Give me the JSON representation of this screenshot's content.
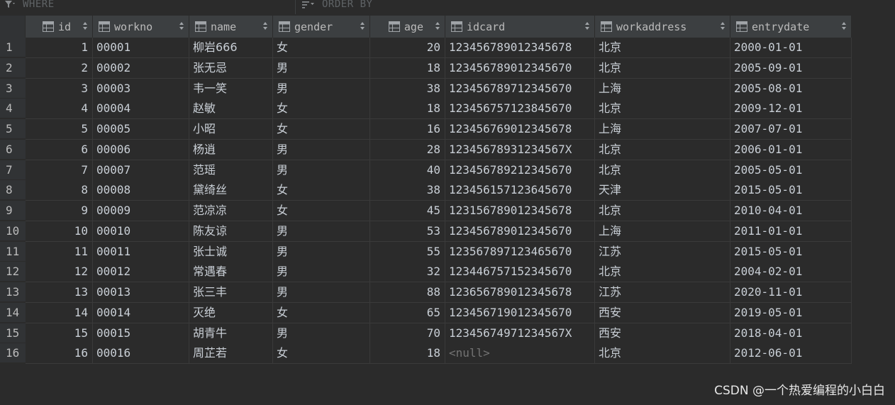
{
  "filter": {
    "where_label": "WHERE",
    "order_by_label": "ORDER BY"
  },
  "columns": [
    {
      "key": "id",
      "label": "id",
      "align": "right"
    },
    {
      "key": "workno",
      "label": "workno",
      "align": "left"
    },
    {
      "key": "name",
      "label": "name",
      "align": "left"
    },
    {
      "key": "gender",
      "label": "gender",
      "align": "left"
    },
    {
      "key": "age",
      "label": "age",
      "align": "right"
    },
    {
      "key": "idcard",
      "label": "idcard",
      "align": "left"
    },
    {
      "key": "workaddress",
      "label": "workaddress",
      "align": "left"
    },
    {
      "key": "entrydate",
      "label": "entrydate",
      "align": "left"
    }
  ],
  "rows": [
    {
      "rownum": "1",
      "id": "1",
      "workno": "00001",
      "name": "柳岩666",
      "gender": "女",
      "age": "20",
      "idcard": "123456789012345678",
      "workaddress": "北京",
      "entrydate": "2000-01-01"
    },
    {
      "rownum": "2",
      "id": "2",
      "workno": "00002",
      "name": "张无忌",
      "gender": "男",
      "age": "18",
      "idcard": "123456789012345670",
      "workaddress": "北京",
      "entrydate": "2005-09-01"
    },
    {
      "rownum": "3",
      "id": "3",
      "workno": "00003",
      "name": "韦一笑",
      "gender": "男",
      "age": "38",
      "idcard": "123456789712345670",
      "workaddress": "上海",
      "entrydate": "2005-08-01"
    },
    {
      "rownum": "4",
      "id": "4",
      "workno": "00004",
      "name": "赵敏",
      "gender": "女",
      "age": "18",
      "idcard": "123456757123845670",
      "workaddress": "北京",
      "entrydate": "2009-12-01"
    },
    {
      "rownum": "5",
      "id": "5",
      "workno": "00005",
      "name": "小昭",
      "gender": "女",
      "age": "16",
      "idcard": "123456769012345678",
      "workaddress": "上海",
      "entrydate": "2007-07-01"
    },
    {
      "rownum": "6",
      "id": "6",
      "workno": "00006",
      "name": "杨逍",
      "gender": "男",
      "age": "28",
      "idcard": "12345678931234567X",
      "workaddress": "北京",
      "entrydate": "2006-01-01"
    },
    {
      "rownum": "7",
      "id": "7",
      "workno": "00007",
      "name": "范瑶",
      "gender": "男",
      "age": "40",
      "idcard": "123456789212345670",
      "workaddress": "北京",
      "entrydate": "2005-05-01"
    },
    {
      "rownum": "8",
      "id": "8",
      "workno": "00008",
      "name": "黛绮丝",
      "gender": "女",
      "age": "38",
      "idcard": "123456157123645670",
      "workaddress": "天津",
      "entrydate": "2015-05-01"
    },
    {
      "rownum": "9",
      "id": "9",
      "workno": "00009",
      "name": "范凉凉",
      "gender": "女",
      "age": "45",
      "idcard": "123156789012345678",
      "workaddress": "北京",
      "entrydate": "2010-04-01"
    },
    {
      "rownum": "10",
      "id": "10",
      "workno": "00010",
      "name": "陈友谅",
      "gender": "男",
      "age": "53",
      "idcard": "123456789012345670",
      "workaddress": "上海",
      "entrydate": "2011-01-01"
    },
    {
      "rownum": "11",
      "id": "11",
      "workno": "00011",
      "name": "张士诚",
      "gender": "男",
      "age": "55",
      "idcard": "123567897123465670",
      "workaddress": "江苏",
      "entrydate": "2015-05-01"
    },
    {
      "rownum": "12",
      "id": "12",
      "workno": "00012",
      "name": "常遇春",
      "gender": "男",
      "age": "32",
      "idcard": "123446757152345670",
      "workaddress": "北京",
      "entrydate": "2004-02-01"
    },
    {
      "rownum": "13",
      "id": "13",
      "workno": "00013",
      "name": "张三丰",
      "gender": "男",
      "age": "88",
      "idcard": "123656789012345678",
      "workaddress": "江苏",
      "entrydate": "2020-11-01"
    },
    {
      "rownum": "14",
      "id": "14",
      "workno": "00014",
      "name": "灭绝",
      "gender": "女",
      "age": "65",
      "idcard": "123456719012345670",
      "workaddress": "西安",
      "entrydate": "2019-05-01"
    },
    {
      "rownum": "15",
      "id": "15",
      "workno": "00015",
      "name": "胡青牛",
      "gender": "男",
      "age": "70",
      "idcard": "12345674971234567X",
      "workaddress": "西安",
      "entrydate": "2018-04-01"
    },
    {
      "rownum": "16",
      "id": "16",
      "workno": "00016",
      "name": "周芷若",
      "gender": "女",
      "age": "18",
      "idcard": "<null>",
      "workaddress": "北京",
      "entrydate": "2012-06-01"
    }
  ],
  "watermark": "CSDN @一个热爱编程的小白白",
  "icons": {
    "where": "filter-icon",
    "order_by": "sort-lines-icon",
    "column": "table-column-icon",
    "sort": "sort-arrows-icon"
  }
}
